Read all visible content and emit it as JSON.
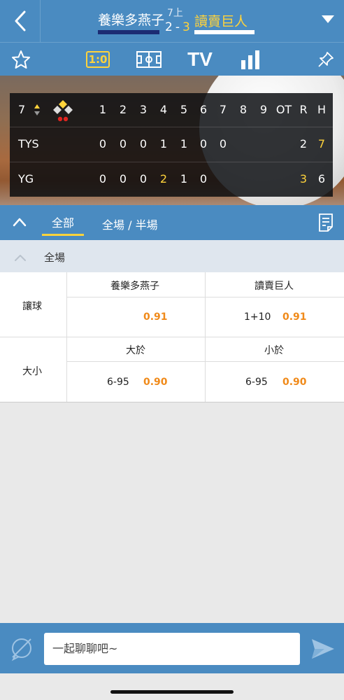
{
  "header": {
    "home_team": "養樂多燕子",
    "inning": "7上",
    "home_score": "2",
    "separator": "-",
    "away_score": "3",
    "away_team": "讀賣巨人"
  },
  "toolbar": {
    "score_label": "1:0",
    "tv_label": "TV"
  },
  "scoreboard": {
    "inning_no": "7",
    "columns": [
      "1",
      "2",
      "3",
      "4",
      "5",
      "6",
      "7",
      "8",
      "9",
      "OT",
      "R",
      "H"
    ],
    "teams": [
      {
        "name": "TYS",
        "innings": [
          "0",
          "0",
          "0",
          "1",
          "1",
          "0",
          "0",
          "",
          "",
          "",
          "2",
          "7"
        ]
      },
      {
        "name": "YG",
        "innings": [
          "0",
          "0",
          "0",
          "2",
          "1",
          "0",
          "",
          "",
          "",
          "",
          "3",
          "6"
        ]
      }
    ]
  },
  "tabs": {
    "all": "全部",
    "full_half": "全場 / 半場"
  },
  "section": {
    "title": "全場"
  },
  "odds": {
    "handicap": {
      "label": "讓球",
      "home_header": "養樂多燕子",
      "away_header": "讀賣巨人",
      "home_line": "",
      "home_odds": "0.91",
      "away_line": "1+10",
      "away_odds": "0.91"
    },
    "totals": {
      "label": "大小",
      "over_header": "大於",
      "under_header": "小於",
      "over_line": "6-95",
      "over_odds": "0.90",
      "under_line": "6-95",
      "under_odds": "0.90"
    }
  },
  "chat": {
    "placeholder": "一起聊聊吧~"
  }
}
